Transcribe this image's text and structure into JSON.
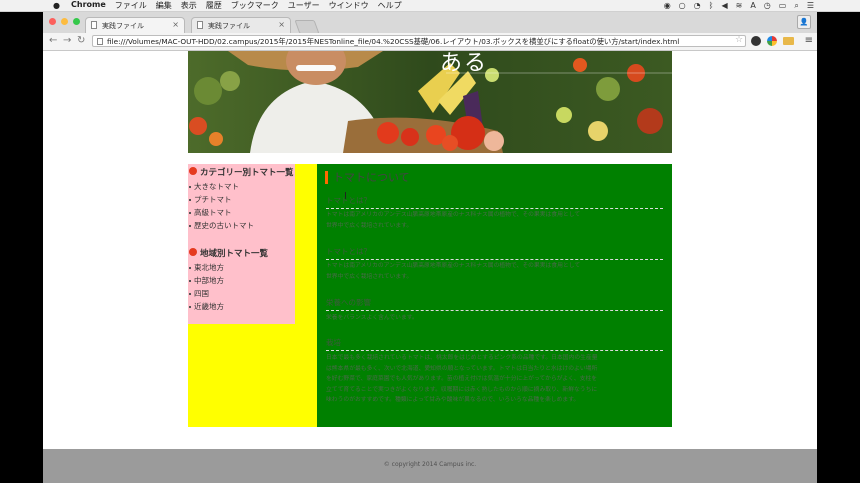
{
  "mac_menubar": {
    "apple_icon": "apple-icon",
    "app_name": "Chrome",
    "menus": [
      "ファイル",
      "編集",
      "表示",
      "履歴",
      "ブックマーク",
      "ユーザー",
      "ウインドウ",
      "ヘルプ"
    ]
  },
  "browser": {
    "tabs": [
      {
        "title": "実践ファイル",
        "active": true
      },
      {
        "title": "実践ファイル",
        "active": false
      }
    ],
    "tab_close": "×",
    "url": "file:///Volumes/MAC-OUT-HDD/02.campus/2015年/2015年NESTonline_file/04.%20CSS基礎/06.レイアウト/03.ボックスを横並びにするfloatの使い方/start/index.html",
    "back_icon": "←",
    "forward_icon": "→",
    "reload_icon": "↻",
    "star_icon": "☆",
    "menu_icon": "≡",
    "profile_icon": "👤"
  },
  "page": {
    "hero_title": "ある",
    "sidebar": {
      "section1": {
        "heading": "カテゴリー別トマト一覧",
        "items": [
          "大きなトマト",
          "プチトマト",
          "高級トマト",
          "歴史の古いトマト"
        ]
      },
      "section2": {
        "heading": "地域別トマト一覧",
        "items": [
          "東北地方",
          "中部地方",
          "四国",
          "近畿地方"
        ]
      }
    },
    "main": {
      "title": "トマトについて",
      "sections": [
        {
          "heading": "トマトとは？",
          "text": [
            "トマトは南アメリカのアンデス山脈高原地帯原産のナス科ナス属の植物で、その果実は食用として",
            "世界中で広く栽培されています。"
          ]
        },
        {
          "heading": "トマトとは？",
          "text": [
            "トマトは南アメリカのアンデス山脈高原地帯原産のナス科ナス属の植物で、その果実は食用として",
            "世界中で広く栽培されています。"
          ]
        },
        {
          "heading": "栄養への影響",
          "text": [
            "栄養をバランスよく含んでいます。"
          ]
        },
        {
          "heading": "栽培",
          "text": [
            "日本で最も多く栽培されているトマトは、桃太郎をはじめとするピンク系の品種です。日本国内の生産量",
            "は熊本県が最も多く、次いで北海道、愛知県の順となっています。トマトは日当たりと水はけのよい場所",
            "を好む野菜で、家庭菜園でも人気があります。苗の植え付けは気温が十分に上がってからがよく、支柱を",
            "立てて育てることで実つきがよくなります。収穫期には赤く熟したものから順に摘み取り、新鮮なうちに",
            "味わうのがおすすめです。種類によって甘みや酸味が異なるので、いろいろな品種を楽しめます。"
          ]
        }
      ]
    },
    "footer": "© copyright 2014 Campus inc."
  },
  "colors": {
    "sidebar_bg": "#ffc0cb",
    "wrapper_bg": "#ffff00",
    "main_bg": "#008000",
    "footer_bg": "#9b9b9b",
    "title_accent": "#ff6a00"
  }
}
